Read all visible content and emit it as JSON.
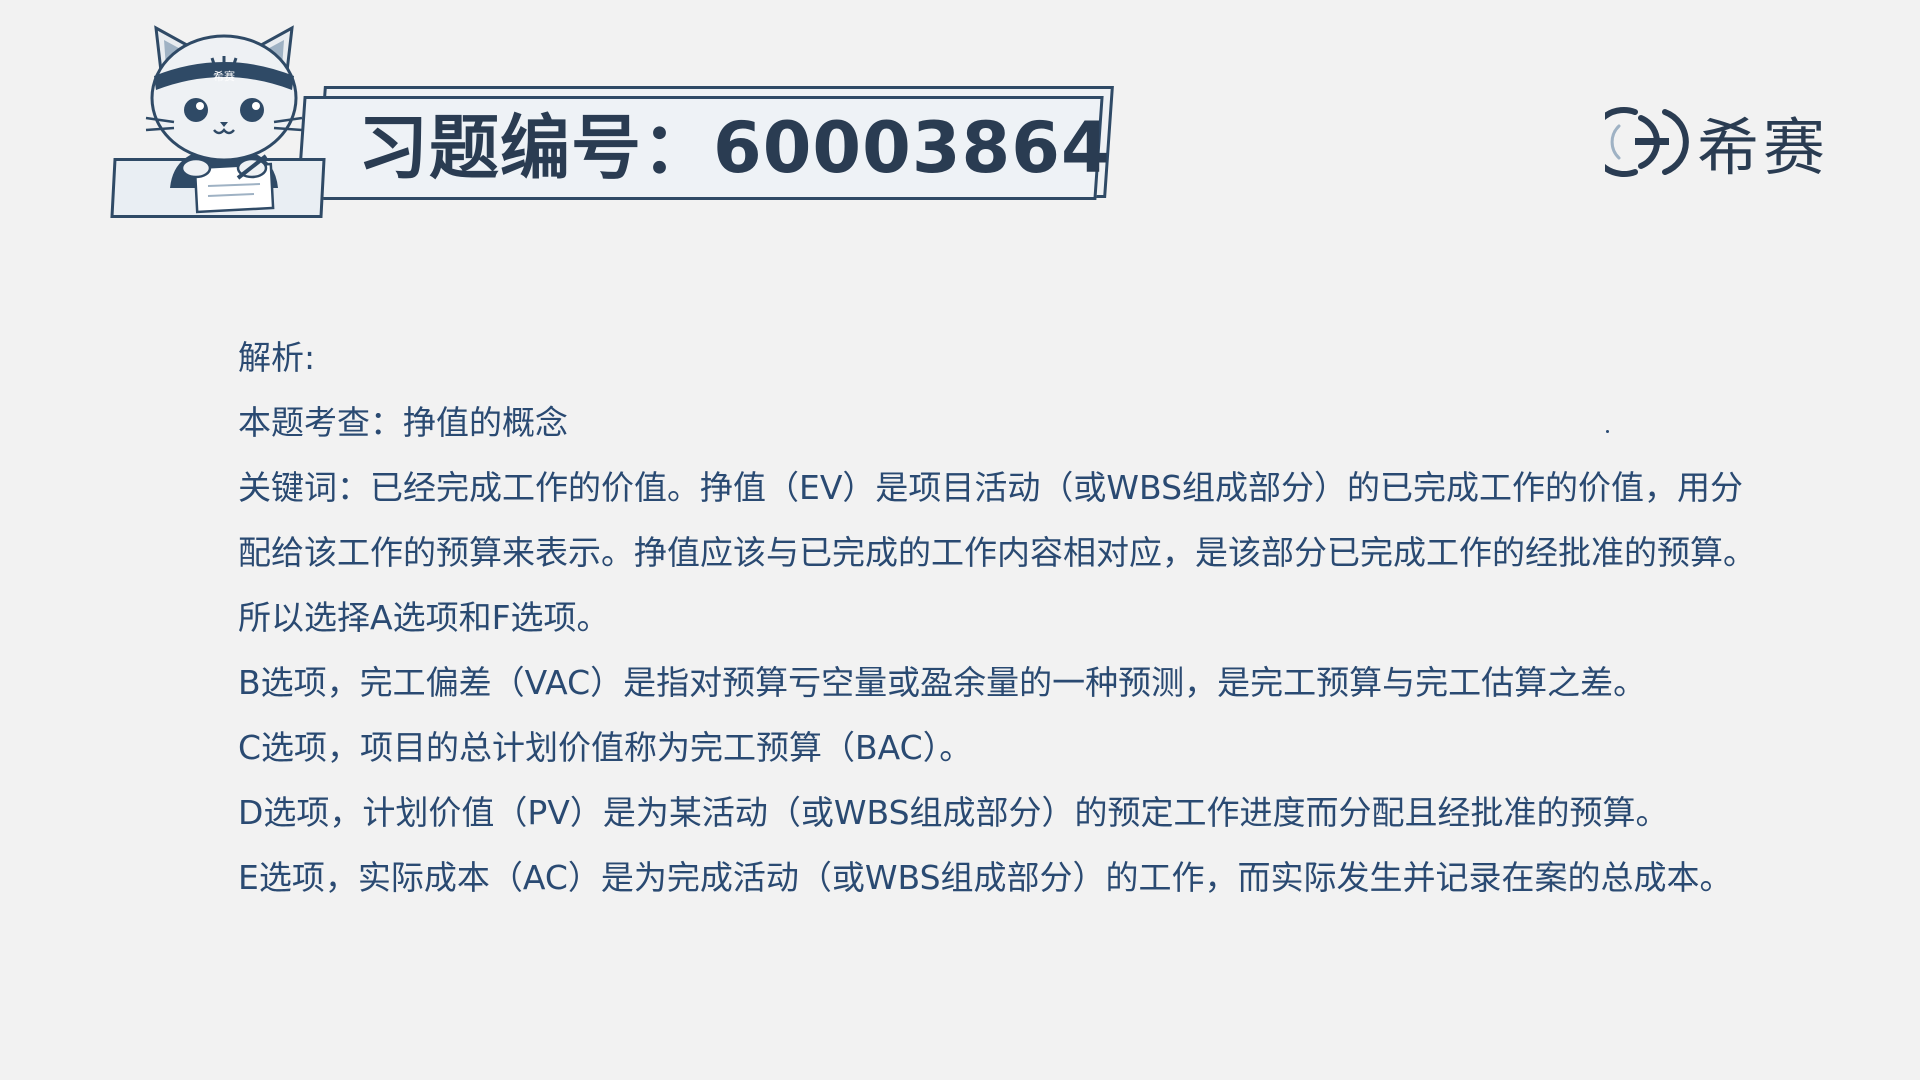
{
  "header": {
    "title": "习题编号：60003864"
  },
  "logo": {
    "text": "希赛",
    "icon": "e-circle-logo-icon"
  },
  "mascot": {
    "icon": "cat-mascot-icon",
    "headband_text": "希赛"
  },
  "analysis": {
    "heading": "解析:",
    "topic": "本题考查：挣值的概念",
    "keywords": "关键词：已经完成工作的价值。挣值（EV）是项目活动（或WBS组成部分）的已完成工作的价值，用分配给该工作的预算来表示。挣值应该与已完成的工作内容相对应，是该部分已完成工作的经批准的预算。所以选择A选项和F选项。",
    "option_b": "B选项，完工偏差（VAC）是指对预算亏空量或盈余量的一种预测，是完工预算与完工估算之差。",
    "option_c": "C选项，项目的总计划价值称为完工预算（BAC）。",
    "option_d": "D选项，计划价值（PV）是为某活动（或WBS组成部分）的预定工作进度而分配且经批准的预算。",
    "option_e": "E选项，实际成本（AC）是为完成活动（或WBS组成部分）的工作，而实际发生并记录在案的总成本。"
  },
  "colors": {
    "background": "#f2f2f2",
    "title": "#2a3c52",
    "body_text": "#2a4a72",
    "outline": "#2f4a66"
  }
}
